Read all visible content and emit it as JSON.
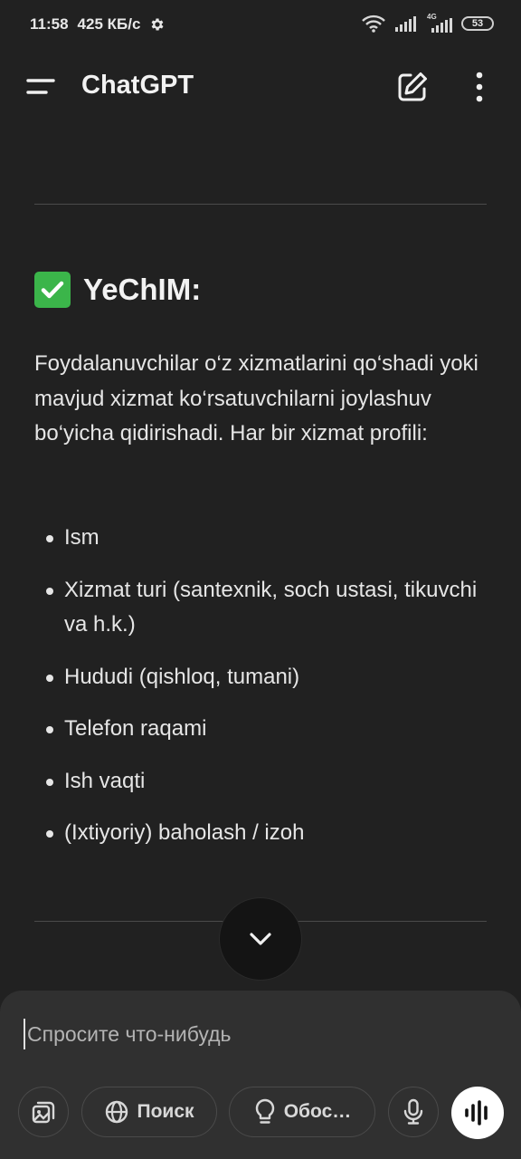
{
  "status_bar": {
    "time": "11:58",
    "speed": "425 КБ/с",
    "network": "4G",
    "battery": "53"
  },
  "header": {
    "title": "ChatGPT",
    "menu_icon": "hamburger-icon",
    "new_chat_icon": "edit-icon",
    "more_icon": "more-vertical-icon"
  },
  "message": {
    "heading_emoji": "check-mark-button-icon",
    "heading": "YeChIM:",
    "paragraph": "Foydalanuvchilar o‘z xizmatlarini qo‘shadi yoki mavjud xizmat ko‘rsatuvchilarni joylashuv bo‘yicha qidirishadi. Har bir xizmat profili:",
    "bullets": [
      "Ism",
      "Xizmat turi (santexnik, soch ustasi, tikuvchi va h.k.)",
      "Hududi (qishloq, tumani)",
      "Telefon raqami",
      "Ish vaqti",
      "(Ixtiyoriy) baholash / izoh"
    ]
  },
  "composer": {
    "placeholder": "Спросите что-нибудь",
    "search_label": "Поиск",
    "reason_label": "Обос…"
  },
  "colors": {
    "background": "#212121",
    "composer": "#303030",
    "accent_check": "#3bb54a"
  }
}
